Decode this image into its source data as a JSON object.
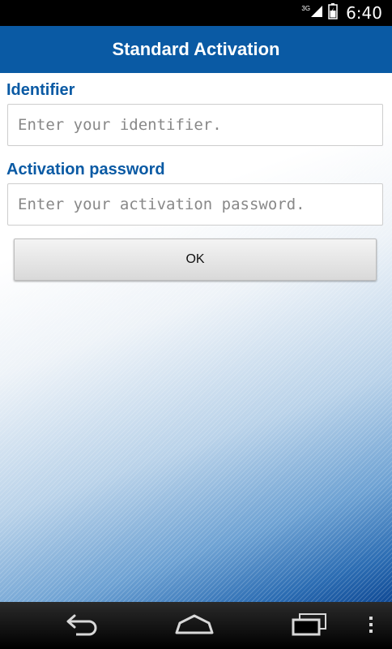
{
  "status_bar": {
    "network_label": "3G",
    "time": "6:40"
  },
  "app_bar": {
    "title": "Standard Activation"
  },
  "form": {
    "identifier_label": "Identifier",
    "identifier_placeholder": "Enter your identifier.",
    "identifier_value": "",
    "password_label": "Activation password",
    "password_placeholder": "Enter your activation password.",
    "password_value": "",
    "ok_label": "OK"
  },
  "nav_bar": {
    "icons": [
      "back-icon",
      "home-icon",
      "recent-apps-icon",
      "menu-icon"
    ]
  },
  "colors": {
    "accent": "#0a5aa4",
    "status_bar": "#000000",
    "nav_bar": "#000000",
    "gradient_end": "#104a95"
  }
}
